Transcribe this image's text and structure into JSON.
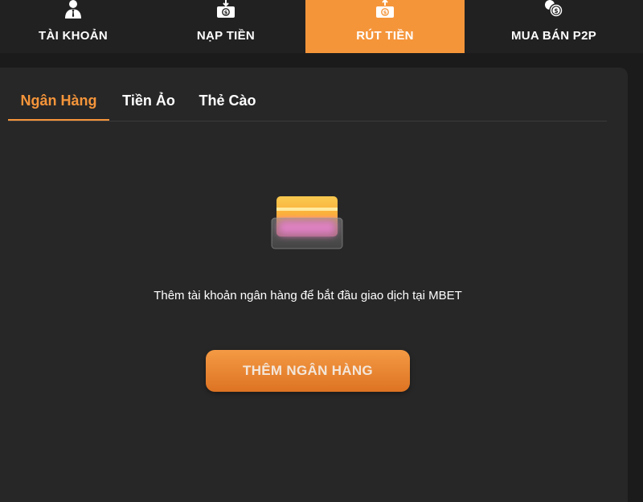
{
  "nav": {
    "items": [
      {
        "label": "TÀI KHOẢN",
        "icon": "user-icon",
        "active": false
      },
      {
        "label": "NẠP TIỀN",
        "icon": "deposit-icon",
        "active": false
      },
      {
        "label": "RÚT TIỀN",
        "icon": "withdraw-icon",
        "active": true
      },
      {
        "label": "MUA BÁN P2P",
        "icon": "coins-icon",
        "active": false
      }
    ]
  },
  "tabs": [
    {
      "label": "Ngân Hàng",
      "active": true
    },
    {
      "label": "Tiền Ảo",
      "active": false
    },
    {
      "label": "Thẻ Cào",
      "active": false
    }
  ],
  "empty_state": {
    "illustration": "bank-card-icon",
    "message": "Thêm tài khoản ngân hàng để bắt đầu giao dịch tại MBET",
    "button_label": "THÊM NGÂN HÀNG"
  },
  "colors": {
    "accent": "#f5953a",
    "nav_background": "#212121",
    "page_background": "#1b1b1b",
    "panel_background": "#272727",
    "text": "#ffffff"
  }
}
